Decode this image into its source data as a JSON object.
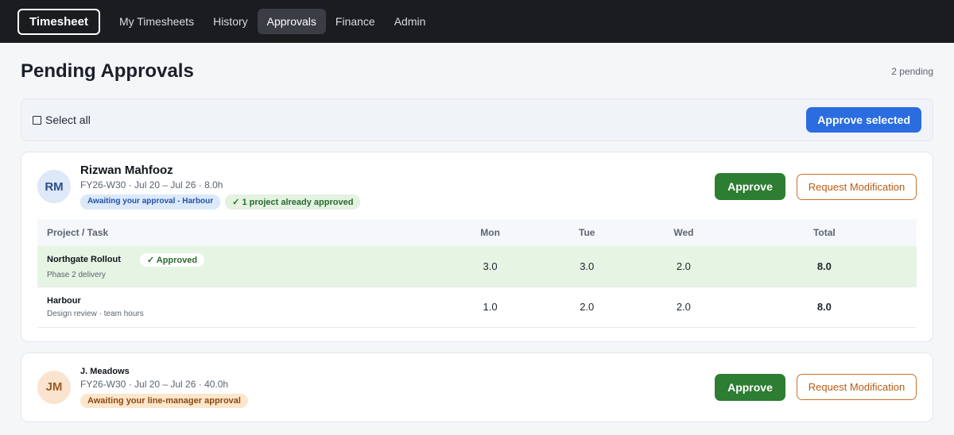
{
  "nav": {
    "brand": "Timesheet",
    "items": [
      {
        "label": "My Timesheets",
        "active": false
      },
      {
        "label": "History",
        "active": false
      },
      {
        "label": "Approvals",
        "active": true
      },
      {
        "label": "Finance",
        "active": false
      },
      {
        "label": "Admin",
        "active": false
      }
    ]
  },
  "page": {
    "title": "Pending Approvals",
    "pending_count": "2 pending"
  },
  "select_bar": {
    "select_all_label": "Select all",
    "approve_selected_label": "Approve selected"
  },
  "cards": [
    {
      "initials": "RM",
      "name": "Rizwan Mahfooz",
      "meta": "FY26-W30 · Jul 20 – Jul 26 · 8.0h",
      "badges": [
        {
          "text": "Awaiting your approval - Harbour",
          "tone": "blue"
        },
        {
          "text": "✓ 1 project already approved",
          "tone": "green"
        }
      ],
      "approve_label": "Approve",
      "modify_label": "Request Modification",
      "table": {
        "headers": [
          "Project / Task",
          "Mon",
          "Tue",
          "Wed",
          "Total"
        ],
        "rows": [
          {
            "project": "Northgate Rollout",
            "task": "Phase 2 delivery",
            "status": "✓ Approved",
            "mon": "3.0",
            "tue": "3.0",
            "wed": "2.0",
            "total": "8.0"
          },
          {
            "project": "Harbour",
            "task": "Design review · team hours",
            "status": "",
            "mon": "1.0",
            "tue": "2.0",
            "wed": "2.0",
            "total": "8.0"
          }
        ]
      }
    },
    {
      "initials": "JM",
      "name": "J. Meadows",
      "meta": "FY26-W30 · Jul 20 – Jul 26 · 40.0h",
      "badges": [
        {
          "text": "Awaiting your line-manager approval",
          "tone": "orange"
        }
      ],
      "approve_label": "Approve",
      "modify_label": "Request Modification"
    }
  ],
  "colors": {
    "topbar": "#1a1c20",
    "primary": "#2b6de0",
    "approve": "#2d7d32",
    "modify": "#b65c16",
    "approved_row": "#e6f4e3"
  }
}
